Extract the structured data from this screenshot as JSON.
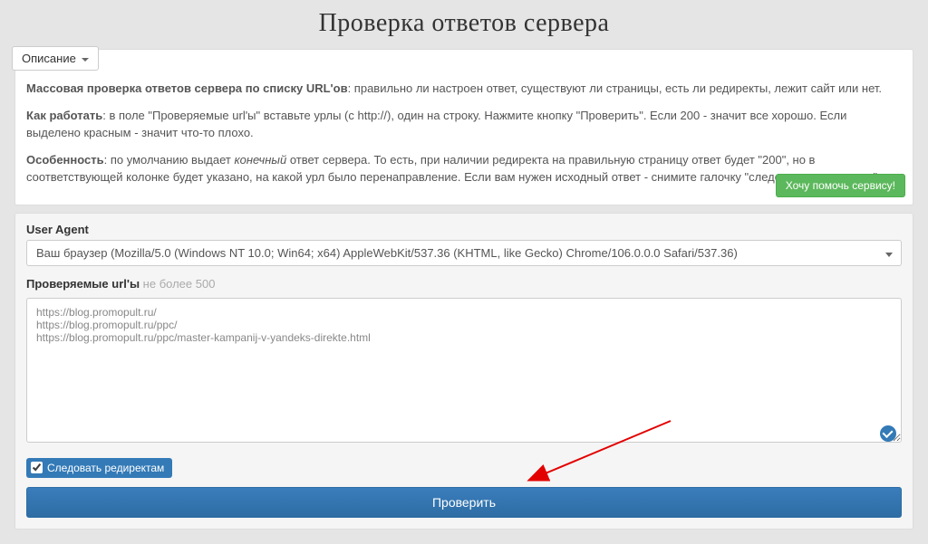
{
  "title": "Проверка ответов сервера",
  "description": {
    "toggle_label": "Описание",
    "p1_bold": "Массовая проверка ответов сервера по списку URL'ов",
    "p1_rest": ": правильно ли настроен ответ, существуют ли страницы, есть ли редиректы, лежит сайт или нет.",
    "p2_bold": "Как работать",
    "p2_rest": ": в поле \"Проверяемые url'ы\" вставьте урлы (с http://), один на строку. Нажмите кнопку \"Проверить\". Если 200 - значит все хорошо. Если выделено красным - значит что-то плохо.",
    "p3_bold": "Особенность",
    "p3_mid1": ": по умолчанию выдает ",
    "p3_em": "конечный",
    "p3_mid2": " ответ сервера. То есть, при наличии редиректа на правильную страницу ответ будет \"200\", но в соответствующей колонке будет указано, на какой урл было перенаправление. Если вам нужен исходный ответ - снимите галочку \"следовать редиректам\".",
    "help_button": "Хочу помочь сервису!"
  },
  "form": {
    "ua_label": "User Agent",
    "ua_value": "Ваш браузер (Mozilla/5.0 (Windows NT 10.0; Win64; x64) AppleWebKit/537.36 (KHTML, like Gecko) Chrome/106.0.0.0 Safari/537.36)",
    "urls_label": "Проверяемые url'ы",
    "urls_limit": " не более 500",
    "urls_value": "https://blog.promopult.ru/\nhttps://blog.promopult.ru/ppc/\nhttps://blog.promopult.ru/ppc/master-kampanij-v-yandeks-direkte.html",
    "follow_redirects_label": "Следовать редиректам",
    "follow_redirects_checked": true,
    "submit_label": "Проверить"
  }
}
